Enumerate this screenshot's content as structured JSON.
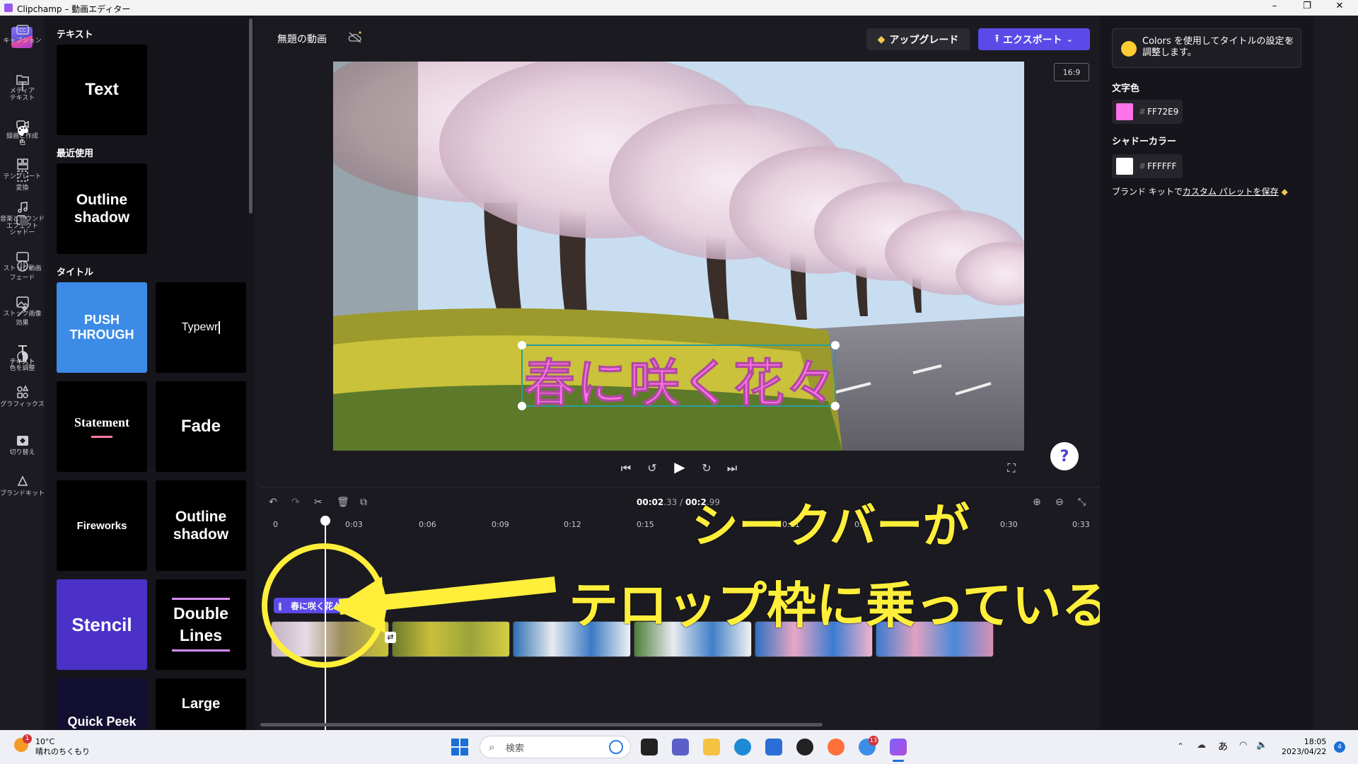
{
  "window": {
    "title": "Clipchamp – 動画エディター"
  },
  "left_rail": {
    "items": [
      {
        "label": "メディア",
        "icon": "folder-icon"
      },
      {
        "label": "録画と作成",
        "icon": "camera-icon"
      },
      {
        "label": "テンプレート",
        "icon": "template-icon"
      },
      {
        "label": "音楽とサウンドエフェクト",
        "icon": "music-icon"
      },
      {
        "label": "ストック動画",
        "icon": "stock-video-icon"
      },
      {
        "label": "ストック画像",
        "icon": "stock-image-icon"
      },
      {
        "label": "テキスト",
        "icon": "text-icon"
      },
      {
        "label": "グラフィックス",
        "icon": "graphics-icon"
      },
      {
        "label": "切り替え",
        "icon": "transition-icon"
      },
      {
        "label": "ブランドキット",
        "icon": "brand-kit-icon"
      }
    ]
  },
  "panel": {
    "section_text": "テキスト",
    "section_recent": "最近使用",
    "section_titles": "タイトル",
    "card_text": "Text",
    "card_outline_shadow": "Outline shadow",
    "card_push_through": "PUSH THROUGH",
    "card_typewriter": "Typewr",
    "card_statement": "Statement",
    "card_fade": "Fade",
    "card_fireworks": "Fireworks",
    "card_outline_shadow_2": "Outline shadow",
    "card_stencil": "Stencil",
    "card_double_lines": "Double Lines",
    "card_quick_peek": "Quick Peek",
    "card_large": "Large"
  },
  "editor": {
    "project_name": "無題の動画",
    "upgrade_label": "アップグレード",
    "export_label": "エクスポート",
    "aspect_ratio": "16:9",
    "caption_text": "春に咲く花々",
    "help": "?"
  },
  "timeline": {
    "time_current": "00:02",
    "time_current_frac": ".33",
    "time_separator": " / ",
    "time_total": "00:2",
    "time_total_frac": ".99",
    "ticks": [
      "0",
      "0:03",
      "0:06",
      "0:09",
      "0:12",
      "0:15",
      "0:21",
      "0:2",
      "0:30",
      "0:33"
    ],
    "text_clip_label": "春に咲く花々"
  },
  "annotations": {
    "line1": "シークバーが",
    "line2": "テロップ枠に乗っている"
  },
  "right_panel": {
    "tip": "Colors を使用してタイトルの設定を調整します。",
    "font_color_label": "文字色",
    "font_color_value": "FF72E9",
    "shadow_color_label": "シャドーカラー",
    "shadow_color_value": "FFFFFF",
    "brand_prefix": "ブランド キットで",
    "brand_link": "カスタム パレットを保存",
    "colors": {
      "font": "#FF72E9",
      "shadow": "#FFFFFF",
      "accent": "#5C4AE8"
    }
  },
  "right_rail": {
    "items": [
      {
        "label": "キャプション",
        "icon": "captions-icon"
      },
      {
        "label": "テキスト",
        "icon": "text-icon"
      },
      {
        "label": "色",
        "icon": "palette-icon"
      },
      {
        "label": "変換",
        "icon": "transform-icon"
      },
      {
        "label": "シャドー",
        "icon": "shadow-icon"
      },
      {
        "label": "フェード",
        "icon": "fade-icon"
      },
      {
        "label": "効果",
        "icon": "effects-icon"
      },
      {
        "label": "色を調整",
        "icon": "adjust-color-icon"
      }
    ]
  },
  "taskbar": {
    "temperature": "10°C",
    "weather": "晴れのちくもり",
    "weather_badge": "1",
    "search_placeholder": "検索",
    "chat_badge": "13",
    "ime": "あ",
    "time": "18:05",
    "date": "2023/04/22",
    "notif_count": "4"
  }
}
